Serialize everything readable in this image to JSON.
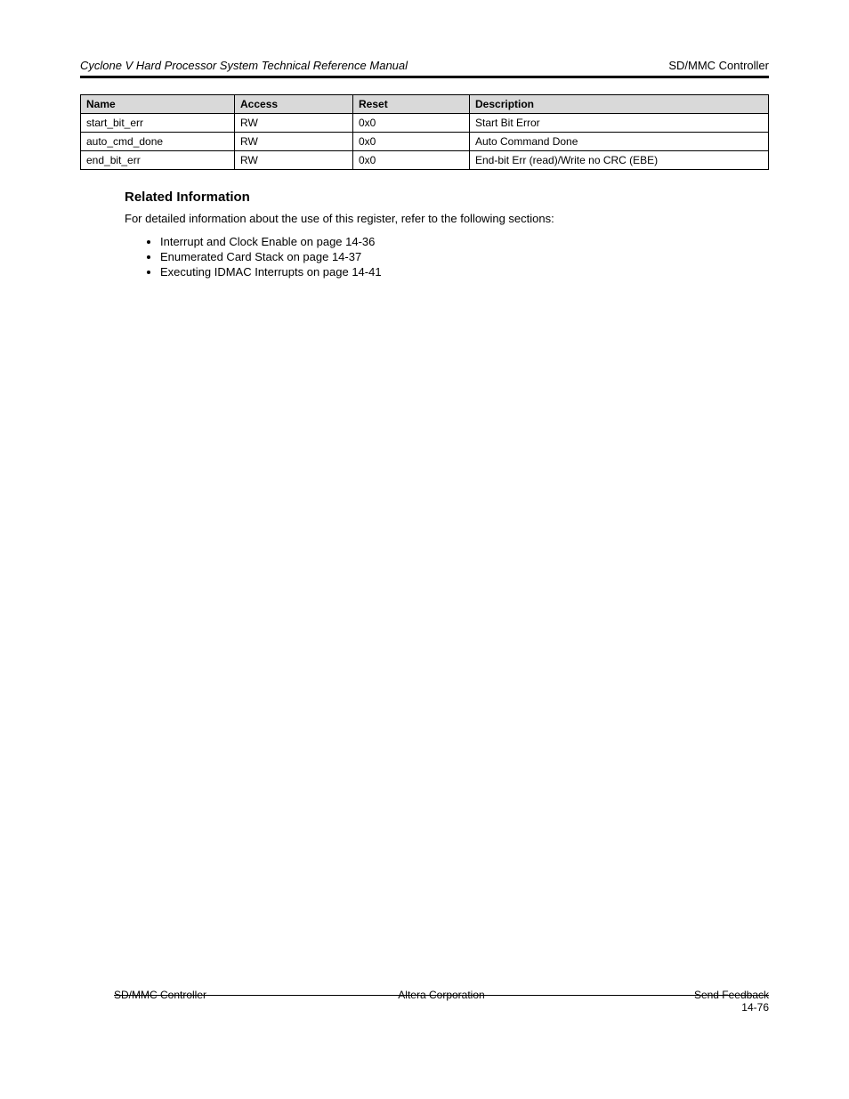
{
  "header": {
    "left": "Cyclone V Hard Processor System Technical Reference Manual",
    "right": "SD/MMC Controller"
  },
  "table": {
    "headers": [
      "Name",
      "Access",
      "Reset",
      "Description"
    ],
    "rows": [
      {
        "name": "start_bit_err",
        "access": "RW",
        "reset": "0x0",
        "desc": "Start Bit Error"
      },
      {
        "name": "auto_cmd_done",
        "access": "RW",
        "reset": "0x0",
        "desc": "Auto Command Done"
      },
      {
        "name": "end_bit_err",
        "access": "RW",
        "reset": "0x0",
        "desc": "End-bit Err (read)/Write no CRC (EBE)"
      }
    ]
  },
  "related_info": {
    "heading": "Related Information",
    "intro": "For detailed information about the use of this register, refer to the following sections:",
    "items": [
      "Interrupt and Clock Enable on page 14-36",
      "Enumerated Card Stack on page 14-37",
      "Executing IDMAC Interrupts on page 14-41"
    ]
  },
  "footer": {
    "left": "SD/MMC Controller",
    "center": "Altera Corporation",
    "right_top": "Send Feedback",
    "page": "14-76"
  },
  "extra_page_number_top": "14-76"
}
